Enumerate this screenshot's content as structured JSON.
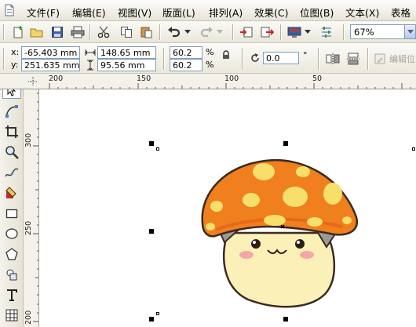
{
  "menu": {
    "items": [
      {
        "label": "文件(F)"
      },
      {
        "label": "编辑(E)"
      },
      {
        "label": "视图(V)"
      },
      {
        "label": "版面(L)"
      },
      {
        "label": "排列(A)"
      },
      {
        "label": "效果(C)"
      },
      {
        "label": "位图(B)"
      },
      {
        "label": "文本(X)"
      },
      {
        "label": "表格"
      }
    ]
  },
  "toolbar": {
    "zoom_value": "67%"
  },
  "properties": {
    "x_label": "x:",
    "x_value": "-65.403 mm",
    "y_label": "y:",
    "y_value": "251.635 mm",
    "width_value": "148.65 mm",
    "height_value": "95.56 mm",
    "scale_w": "60.2",
    "scale_h": "60.2",
    "percent_w": "%",
    "percent_h": "%",
    "rotation_value": "0.0",
    "degree_symbol": "°",
    "edit_bitmap_label": "编辑位"
  },
  "ruler": {
    "horizontal_ticks": [
      "200",
      "150",
      "100",
      "50"
    ],
    "vertical_ticks": [
      "300",
      "250",
      "200"
    ]
  },
  "colors": {
    "mushroom_cap": "#f07f1e",
    "mushroom_spots": "#f8df6b",
    "mushroom_face": "#fbf0b8",
    "cheeks": "#f6a6a6",
    "handle": "#000000"
  }
}
